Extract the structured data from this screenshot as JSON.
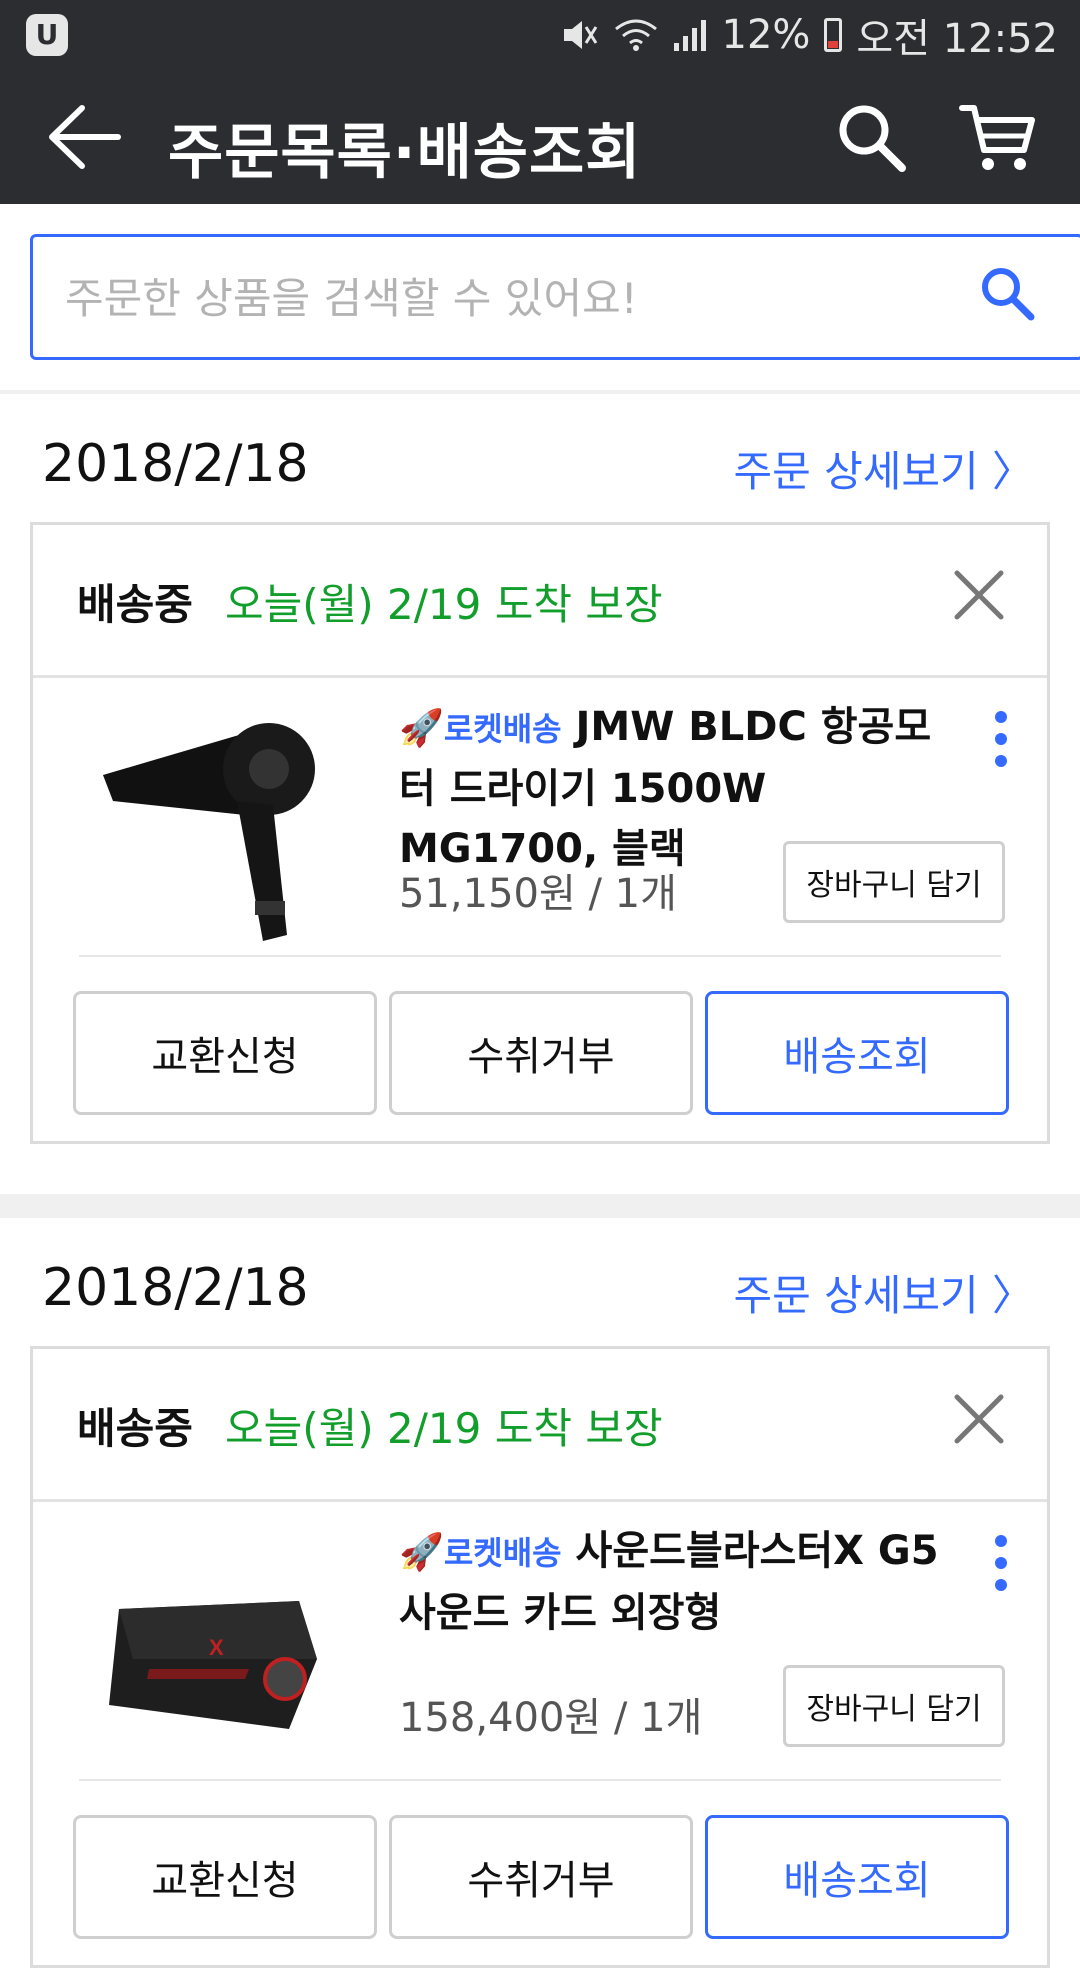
{
  "status_bar": {
    "battery": "12%",
    "time": "오전 12:52",
    "logo": "U",
    "icons": [
      "mute-icon",
      "wifi-icon",
      "signal-icon",
      "battery-icon"
    ]
  },
  "app_bar": {
    "title": "주문목록·배송조회"
  },
  "search": {
    "placeholder": "주문한 상품을 검색할 수 있어요!",
    "value": ""
  },
  "colors": {
    "accent": "#346aff",
    "eta_green": "#119e2b",
    "header_bg": "#2b2d31"
  },
  "orders": [
    {
      "date": "2018/2/18",
      "detail_link": "주문 상세보기 〉",
      "status": "배송중",
      "eta": "오늘(월) 2/19 도착 보장",
      "badge": "로켓배송",
      "product_name": "JMW BLDC 항공모터 드라이기 1500W MG1700, 블랙",
      "price_qty": "51,150원 / 1개",
      "add_cart": "장바구니 담기",
      "actions": [
        "교환신청",
        "수취거부",
        "배송조회"
      ]
    },
    {
      "date": "2018/2/18",
      "detail_link": "주문 상세보기 〉",
      "status": "배송중",
      "eta": "오늘(월) 2/19 도착 보장",
      "badge": "로켓배송",
      "product_name": "사운드블라스터X G5사운드 카드 외장형",
      "price_qty": "158,400원 / 1개",
      "add_cart": "장바구니 담기",
      "actions": [
        "교환신청",
        "수취거부",
        "배송조회"
      ]
    }
  ]
}
